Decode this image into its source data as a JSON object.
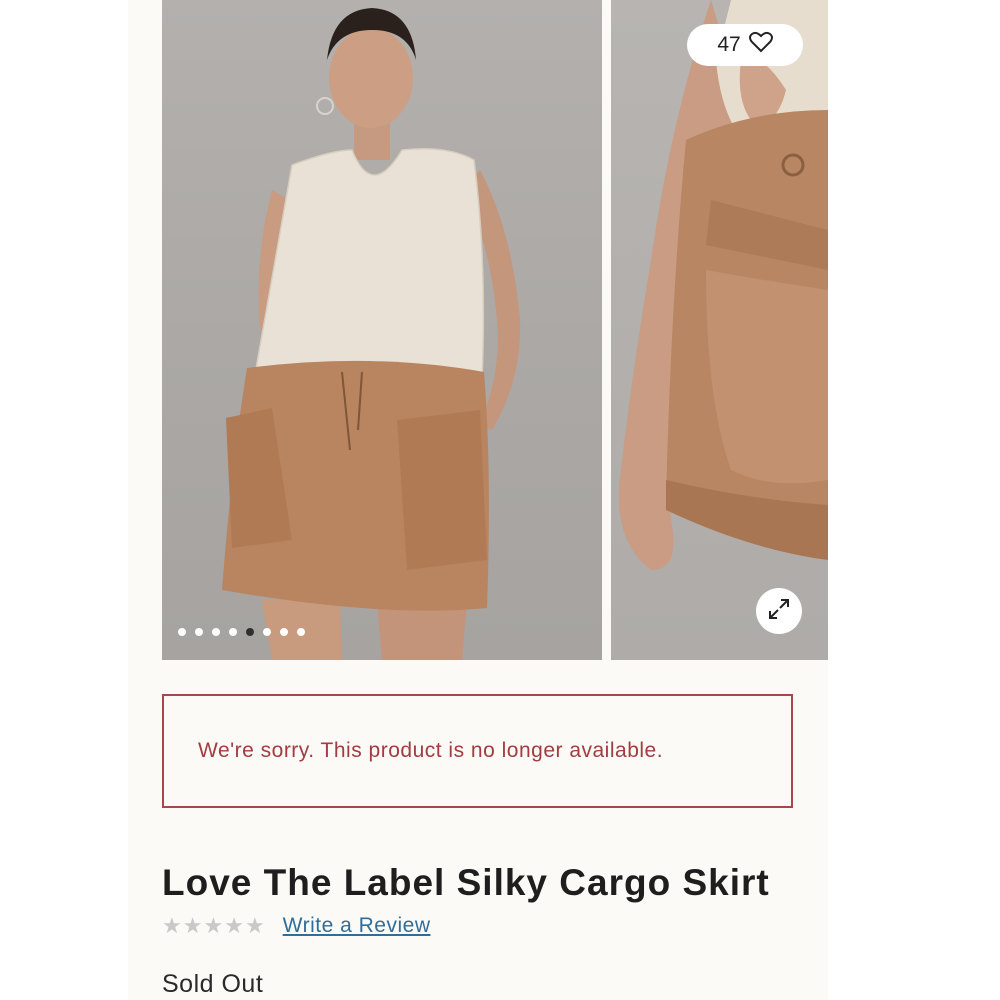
{
  "gallery": {
    "dots_total": 8,
    "active_dot_index": 4,
    "like_count": "47",
    "icons": {
      "like": "heart-outline-icon",
      "expand": "expand-arrows-icon"
    }
  },
  "notice": {
    "message": "We're sorry. This product is no longer available.",
    "color": "#a23c40"
  },
  "product": {
    "title": "Love The Label Silky Cargo Skirt",
    "rating_stars": 0,
    "rating_max": 5,
    "review_link_label": "Write a Review",
    "availability": "Sold Out"
  }
}
